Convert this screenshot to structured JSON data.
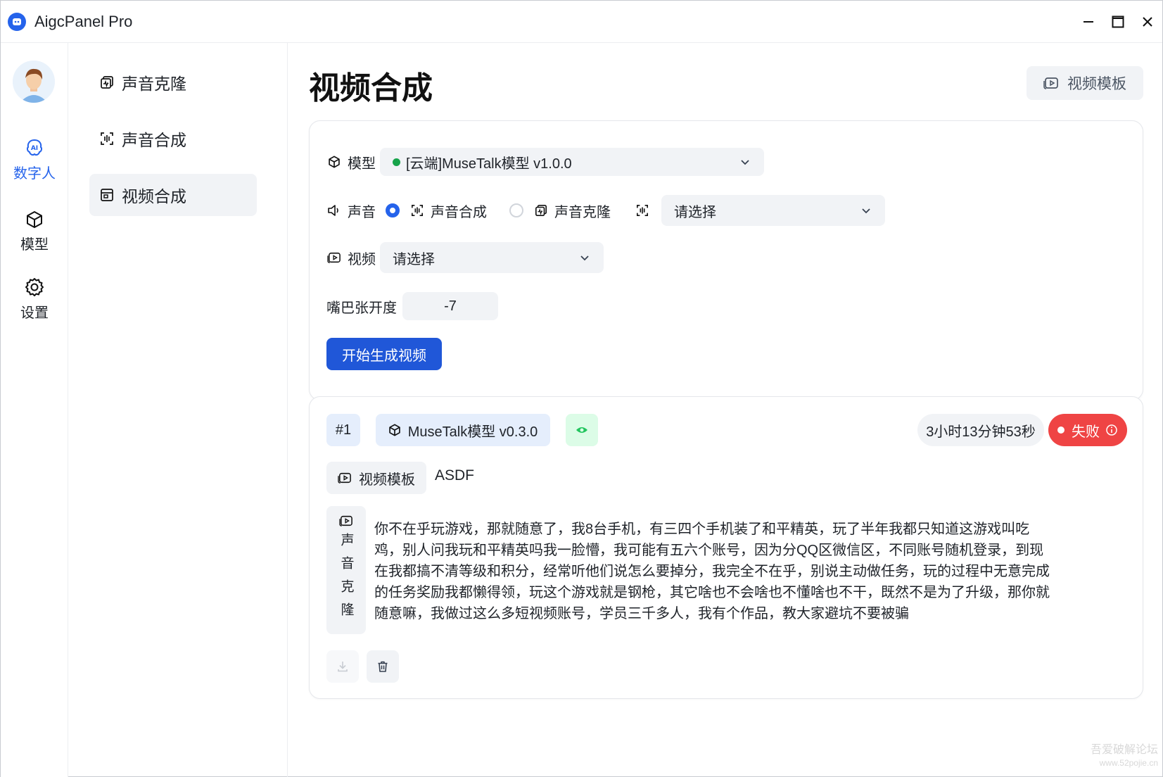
{
  "app": {
    "title": "AigcPanel Pro"
  },
  "rail": [
    {
      "label": "数字人",
      "icon": "ai-brain-icon",
      "active": true
    },
    {
      "label": "模型",
      "icon": "cube-icon",
      "active": false
    },
    {
      "label": "设置",
      "icon": "gear-icon",
      "active": false
    }
  ],
  "subnav": [
    {
      "label": "声音克隆",
      "icon": "voice-clone-icon"
    },
    {
      "label": "声音合成",
      "icon": "voice-synth-icon"
    },
    {
      "label": "视频合成",
      "icon": "video-synth-icon",
      "active": true
    }
  ],
  "main": {
    "title": "视频合成",
    "template_button": "视频模板"
  },
  "form": {
    "model_label": "模型",
    "model_value": "[云端]MuseTalk模型 v1.0.0",
    "voice_label": "声音",
    "voice_option_synth": "声音合成",
    "voice_option_clone": "声音克隆",
    "voice_selected": "声音合成",
    "voice_select_placeholder": "请选择",
    "video_label": "视频",
    "video_placeholder": "请选择",
    "mouth_label": "嘴巴张开度",
    "mouth_value": "-7",
    "submit": "开始生成视频"
  },
  "task": {
    "index": "#1",
    "model": "MuseTalk模型 v0.3.0",
    "duration": "3小时13分钟53秒",
    "status": "失败",
    "status_color": "#ef4444",
    "template_label": "视频模板",
    "template_name": "ASDF",
    "voice_type": "声音克隆",
    "text": "你不在乎玩游戏，那就随意了，我8台手机，有三四个手机装了和平精英，玩了半年我都只知道这游戏叫吃鸡，别人问我玩和平精英吗我一脸懵，我可能有五六个账号，因为分QQ区微信区，不同账号随机登录，到现在我都搞不清等级和积分，经常听他们说怎么要掉分，我完全不在乎，别说主动做任务，玩的过程中无意完成的任务奖励我都懒得领，玩这个游戏就是钢枪，其它啥也不会啥也不懂啥也不干，既然不是为了升级，那你就随意嘛，我做过这么多短视频账号，学员三千多人，我有个作品，教大家避坑不要被骗"
  },
  "watermark": {
    "line1": "吾爱破解论坛",
    "line2": "www.52pojie.cn"
  },
  "colors": {
    "primary": "#2057d8",
    "active_nav": "#2563eb",
    "success_dot": "#16a34a",
    "danger": "#ef4444"
  }
}
